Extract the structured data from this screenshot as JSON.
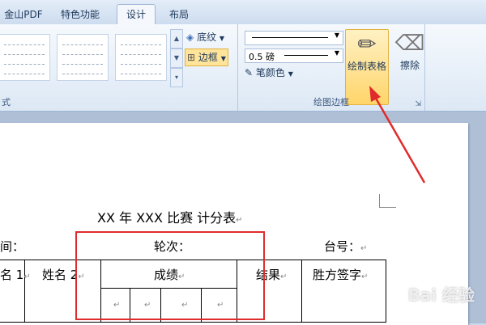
{
  "tabs": [
    {
      "label": "金山PDF"
    },
    {
      "label": "特色功能"
    },
    {
      "label": "设计"
    },
    {
      "label": "布局"
    }
  ],
  "ribbon": {
    "styles_group_label": "式",
    "shading_label": "底纹",
    "borders_label": "边框",
    "line_weight": "0.5 磅",
    "pen_color_label": "笔颜色",
    "draw_table_label": "绘制表格",
    "eraser_label": "擦除",
    "draw_borders_group_label": "绘图边框"
  },
  "document": {
    "title": "XX 年 XXX 比赛  计分表",
    "left_label": "间：",
    "round_label": "轮次：",
    "table_no_label": "台号：",
    "header": [
      "名 1",
      "姓名 2",
      "成绩",
      "结果",
      "胜方签字"
    ],
    "paragraph_mark": "↵"
  },
  "watermark": "Bai 经验",
  "colors": {
    "annotation": "#e02b2b",
    "highlight": "#ffd56a"
  }
}
